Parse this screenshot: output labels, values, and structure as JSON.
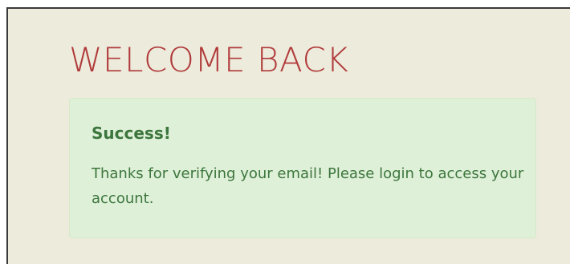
{
  "page": {
    "title": "WELCOME BACK"
  },
  "alert": {
    "heading": "Success!",
    "message": "Thanks for verifying your email! Please login to access your account."
  },
  "colors": {
    "background": "#edebdc",
    "title": "#b03a3a",
    "alert_background": "#dff0d8",
    "alert_border": "#d6e9c6",
    "alert_text": "#3c763d"
  }
}
